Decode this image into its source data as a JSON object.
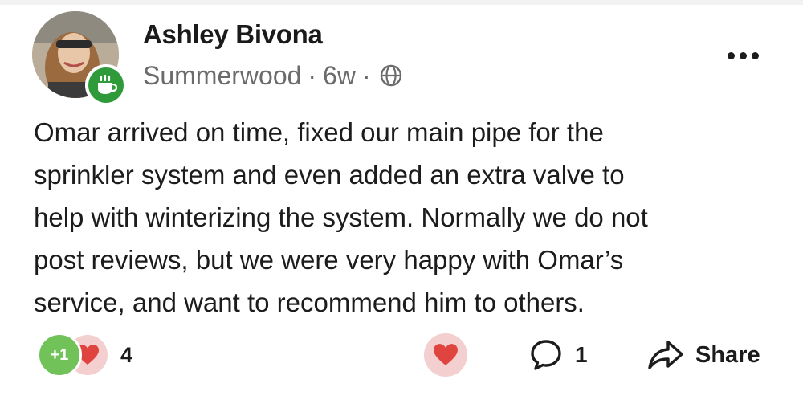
{
  "post": {
    "author": "Ashley Bivona",
    "neighborhood": "Summerwood",
    "age": "6w",
    "separator": "·",
    "visibility_icon": "globe-icon",
    "body_lines": [
      "Omar arrived on time, fixed our main pipe for the",
      "sprinkler system and even added an extra valve to",
      "help with winterizing the system. Normally we do not",
      "post reviews, but we were very happy with Omar’s",
      "service, and want to recommend him to others."
    ]
  },
  "reactions": {
    "plus_one_label": "+1",
    "count": "4",
    "icons": [
      "plus-one-icon",
      "heart-icon"
    ]
  },
  "actions": {
    "comment_count": "1",
    "share_label": "Share"
  },
  "colors": {
    "badge_green": "#2f9a3a",
    "plus_one_green": "#72c25a",
    "heart_red": "#e0443e",
    "heart_bg": "#f3cfcf",
    "meta_gray": "#6b6b6b"
  }
}
